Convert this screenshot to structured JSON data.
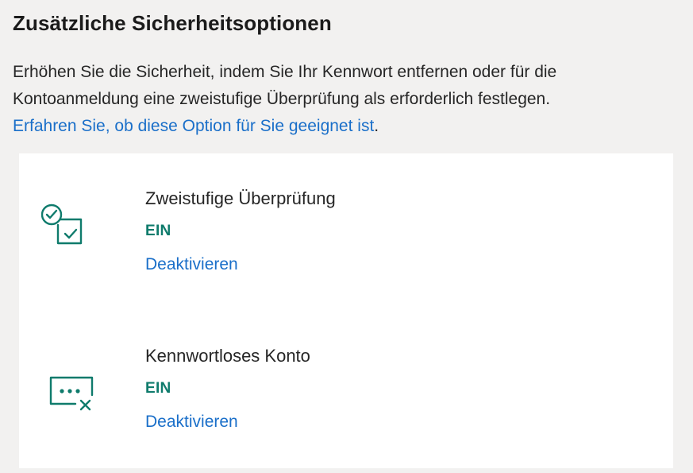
{
  "section": {
    "title": "Zusätzliche Sicherheitsoptionen",
    "description_line1": "Erhöhen Sie die Sicherheit, indem Sie Ihr Kennwort entfernen oder für die",
    "description_line2": "Kontoanmeldung eine zweistufige Überprüfung als erforderlich festlegen.",
    "learn_more_link": "Erfahren Sie, ob diese Option für Sie geeignet ist",
    "learn_more_suffix": "."
  },
  "options": [
    {
      "icon": "two-step-verification-icon",
      "title": "Zweistufige Überprüfung",
      "status": "EIN",
      "action": "Deaktivieren"
    },
    {
      "icon": "passwordless-account-icon",
      "title": "Kennwortloses Konto",
      "status": "EIN",
      "action": "Deaktivieren"
    }
  ],
  "colors": {
    "background": "#f2f1f0",
    "card": "#ffffff",
    "accent_green": "#0f7b6c",
    "link_blue": "#1a6fc9"
  }
}
